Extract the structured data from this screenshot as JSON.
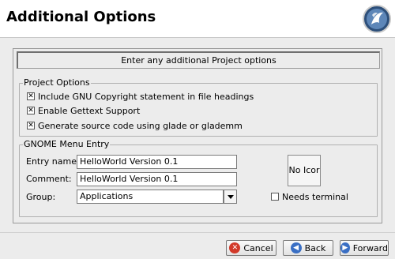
{
  "header": {
    "title": "Additional Options"
  },
  "banner": {
    "text": "Enter any additional Project options"
  },
  "project_options": {
    "title": "Project Options",
    "items": [
      {
        "label": "Include GNU Copyright statement in file headings",
        "checked": true
      },
      {
        "label": "Enable Gettext Support",
        "checked": true
      },
      {
        "label": "Generate source code using glade or glademm",
        "checked": true
      }
    ]
  },
  "gnome_menu": {
    "title": "GNOME Menu Entry",
    "entry_name_label": "Entry name:",
    "entry_name_value": "HelloWorld Version 0.1",
    "comment_label": "Comment:",
    "comment_value": "HelloWorld Version 0.1",
    "group_label": "Group:",
    "group_value": "Applications",
    "icon_button_label": "No Icor",
    "needs_terminal_label": "Needs terminal",
    "needs_terminal_checked": false
  },
  "buttons": {
    "cancel": "Cancel",
    "back": "Back",
    "forward": "Forward"
  },
  "colors": {
    "cancel_icon": "#d23a2a",
    "nav_icon": "#3a6fc4"
  },
  "icons": {
    "logo": "gnome-foot-logo-icon",
    "cancel": "cancel-x-icon",
    "back": "arrow-left-icon",
    "forward": "arrow-right-icon"
  }
}
